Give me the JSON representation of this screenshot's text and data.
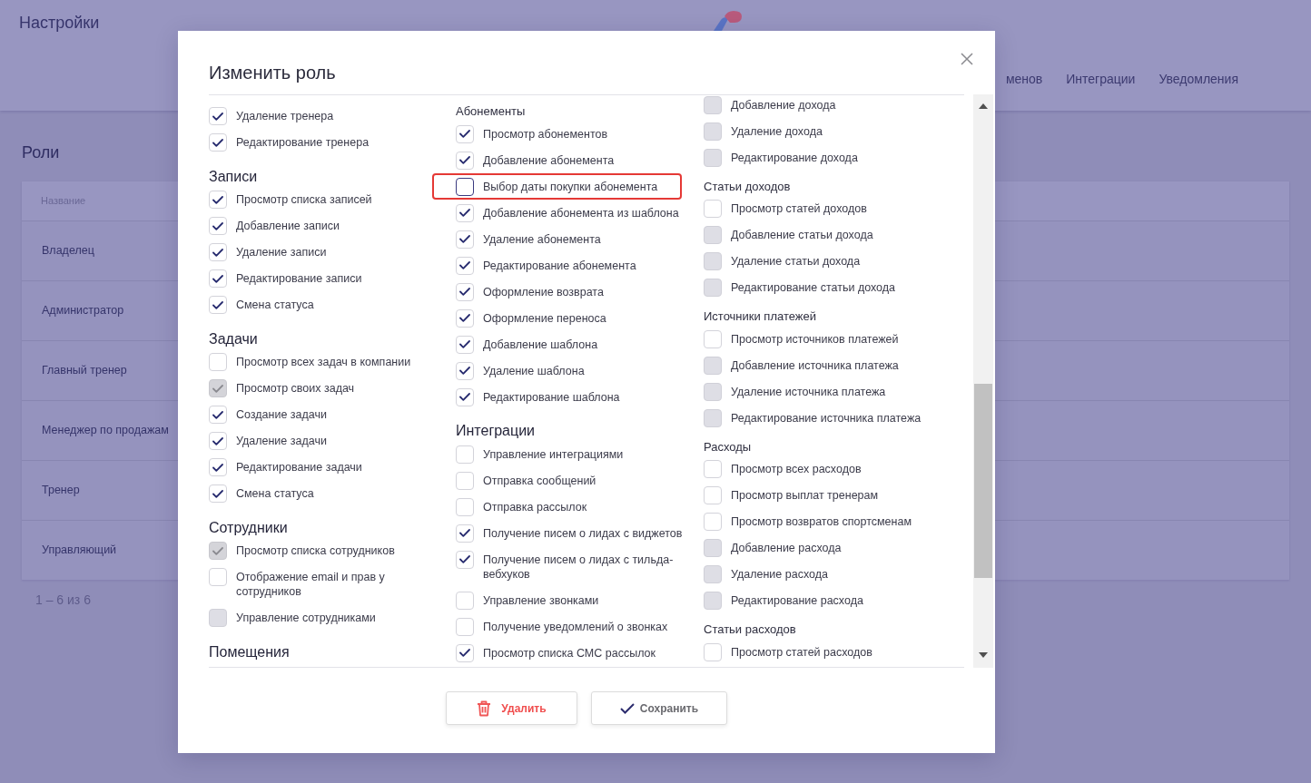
{
  "header": {
    "title": "Настройки",
    "tabs": [
      {
        "label": "менов",
        "selected": false
      },
      {
        "label": "Интеграции",
        "selected": false
      },
      {
        "label": "Уведомления",
        "selected": false
      }
    ]
  },
  "roles": {
    "title": "Роли",
    "table": {
      "columns": [
        "Название"
      ],
      "rows": [
        [
          "Владелец"
        ],
        [
          "Администратор"
        ],
        [
          "Главный тренер"
        ],
        [
          "Менеджер по продажам"
        ],
        [
          "Тренер"
        ],
        [
          "Управляющий"
        ]
      ]
    },
    "pagination": "1 – 6 из 6"
  },
  "modal": {
    "title": "Изменить роль",
    "columns": [
      {
        "sections": [
          {
            "items": [
              {
                "label": "Удаление тренера",
                "checked": true,
                "disabled": false,
                "highlighted": false
              },
              {
                "label": "Редактирование тренера",
                "checked": true,
                "disabled": false,
                "highlighted": false
              }
            ]
          },
          {
            "title": "Записи",
            "kind": "group",
            "items": [
              {
                "label": "Просмотр списка записей",
                "checked": true,
                "disabled": false,
                "highlighted": false
              },
              {
                "label": "Добавление записи",
                "checked": true,
                "disabled": false,
                "highlighted": false
              },
              {
                "label": "Удаление записи",
                "checked": true,
                "disabled": false,
                "highlighted": false
              },
              {
                "label": "Редактирование записи",
                "checked": true,
                "disabled": false,
                "highlighted": false
              },
              {
                "label": "Смена статуса",
                "checked": true,
                "disabled": false,
                "highlighted": false
              }
            ]
          },
          {
            "title": "Задачи",
            "kind": "group",
            "items": [
              {
                "label": "Просмотр всех задач в компании",
                "checked": false,
                "disabled": false,
                "highlighted": false
              },
              {
                "label": "Просмотр своих задач",
                "checked": true,
                "disabled": true,
                "highlighted": false
              },
              {
                "label": "Создание задачи",
                "checked": true,
                "disabled": false,
                "highlighted": false
              },
              {
                "label": "Удаление задачи",
                "checked": true,
                "disabled": false,
                "highlighted": false
              },
              {
                "label": "Редактирование задачи",
                "checked": true,
                "disabled": false,
                "highlighted": false
              },
              {
                "label": "Смена статуса",
                "checked": true,
                "disabled": false,
                "highlighted": false
              }
            ]
          },
          {
            "title": "Сотрудники",
            "kind": "group",
            "items": [
              {
                "label": "Просмотр списка сотрудников",
                "checked": true,
                "disabled": true,
                "highlighted": false
              },
              {
                "label": "Отображение email и прав у сотрудников",
                "checked": false,
                "disabled": false,
                "highlighted": false
              },
              {
                "label": "Управление сотрудниками",
                "checked": false,
                "disabled": true,
                "highlighted": false
              }
            ]
          },
          {
            "title": "Помещения",
            "kind": "group"
          }
        ]
      },
      {
        "sections": [
          {
            "title": "Абонементы",
            "kind": "subgroup",
            "items": [
              {
                "label": "Просмотр абонементов",
                "checked": true,
                "disabled": false,
                "highlighted": false
              },
              {
                "label": "Добавление абонемента",
                "checked": true,
                "disabled": false,
                "highlighted": false
              },
              {
                "label": "Выбор даты покупки абонемента",
                "checked": false,
                "disabled": false,
                "highlighted": true
              },
              {
                "label": "Добавление абонемента из шаблона",
                "checked": true,
                "disabled": false,
                "highlighted": false
              },
              {
                "label": "Удаление абонемента",
                "checked": true,
                "disabled": false,
                "highlighted": false
              },
              {
                "label": "Редактирование абонемента",
                "checked": true,
                "disabled": false,
                "highlighted": false
              },
              {
                "label": "Оформление возврата",
                "checked": true,
                "disabled": false,
                "highlighted": false
              },
              {
                "label": "Оформление переноса",
                "checked": true,
                "disabled": false,
                "highlighted": false
              },
              {
                "label": "Добавление шаблона",
                "checked": true,
                "disabled": false,
                "highlighted": false
              },
              {
                "label": "Удаление шаблона",
                "checked": true,
                "disabled": false,
                "highlighted": false
              },
              {
                "label": "Редактирование шаблона",
                "checked": true,
                "disabled": false,
                "highlighted": false
              }
            ]
          },
          {
            "title": "Интеграции",
            "kind": "group",
            "items": [
              {
                "label": "Управление интеграциями",
                "checked": false,
                "disabled": false,
                "highlighted": false
              },
              {
                "label": "Отправка сообщений",
                "checked": false,
                "disabled": false,
                "highlighted": false
              },
              {
                "label": "Отправка рассылок",
                "checked": false,
                "disabled": false,
                "highlighted": false
              },
              {
                "label": "Получение писем о лидах с виджетов",
                "checked": true,
                "disabled": false,
                "highlighted": false
              },
              {
                "label": "Получение писем о лидах с тильда-вебхуков",
                "checked": true,
                "disabled": false,
                "highlighted": false
              },
              {
                "label": "Управление звонками",
                "checked": false,
                "disabled": false,
                "highlighted": false
              },
              {
                "label": "Получение уведомлений о звонках",
                "checked": false,
                "disabled": false,
                "highlighted": false
              },
              {
                "label": "Просмотр списка СМС рассылок",
                "checked": true,
                "disabled": false,
                "highlighted": false
              }
            ]
          }
        ]
      },
      {
        "sections": [
          {
            "items": [
              {
                "label": "Добавление дохода",
                "checked": false,
                "disabled": true,
                "highlighted": false
              },
              {
                "label": "Удаление дохода",
                "checked": false,
                "disabled": true,
                "highlighted": false
              },
              {
                "label": "Редактирование дохода",
                "checked": false,
                "disabled": true,
                "highlighted": false
              }
            ]
          },
          {
            "title": "Статьи доходов",
            "kind": "subgroup",
            "items": [
              {
                "label": "Просмотр статей доходов",
                "checked": false,
                "disabled": false,
                "highlighted": false
              },
              {
                "label": "Добавление статьи дохода",
                "checked": false,
                "disabled": true,
                "highlighted": false
              },
              {
                "label": "Удаление статьи дохода",
                "checked": false,
                "disabled": true,
                "highlighted": false
              },
              {
                "label": "Редактирование статьи дохода",
                "checked": false,
                "disabled": true,
                "highlighted": false
              }
            ]
          },
          {
            "title": "Источники платежей",
            "kind": "subgroup",
            "items": [
              {
                "label": "Просмотр источников платежей",
                "checked": false,
                "disabled": false,
                "highlighted": false
              },
              {
                "label": "Добавление источника платежа",
                "checked": false,
                "disabled": true,
                "highlighted": false
              },
              {
                "label": "Удаление источника платежа",
                "checked": false,
                "disabled": true,
                "highlighted": false
              },
              {
                "label": "Редактирование источника платежа",
                "checked": false,
                "disabled": true,
                "highlighted": false
              }
            ]
          },
          {
            "title": "Расходы",
            "kind": "subgroup",
            "items": [
              {
                "label": "Просмотр всех расходов",
                "checked": false,
                "disabled": false,
                "highlighted": false
              },
              {
                "label": "Просмотр выплат тренерам",
                "checked": false,
                "disabled": false,
                "highlighted": false
              },
              {
                "label": "Просмотр возвратов спортсменам",
                "checked": false,
                "disabled": false,
                "highlighted": false
              },
              {
                "label": "Добавление расхода",
                "checked": false,
                "disabled": true,
                "highlighted": false
              },
              {
                "label": "Удаление расхода",
                "checked": false,
                "disabled": true,
                "highlighted": false
              },
              {
                "label": "Редактирование расхода",
                "checked": false,
                "disabled": true,
                "highlighted": false
              }
            ]
          },
          {
            "title": "Статьи расходов",
            "kind": "subgroup",
            "items": [
              {
                "label": "Просмотр статей расходов",
                "checked": false,
                "disabled": false,
                "highlighted": false
              }
            ]
          }
        ]
      }
    ],
    "buttons": [
      {
        "kind": "delete",
        "label": "Удалить"
      },
      {
        "kind": "save",
        "label": "Сохранить"
      }
    ]
  }
}
